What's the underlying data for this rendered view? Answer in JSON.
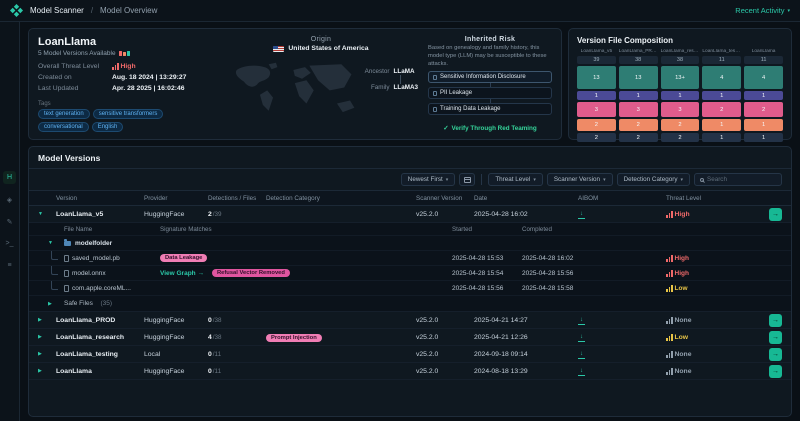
{
  "icons": {
    "caret_down": "▼",
    "caret_right": "▶",
    "caret_small": "▾",
    "arrow": "→",
    "download": "↓",
    "check": "✓"
  },
  "colors": {
    "accent": "#2bc8a8",
    "threat_high": "#f16a6a",
    "threat_low": "#e8c547",
    "threat_none": "#93a1ae"
  },
  "topbar": {
    "breadcrumb": [
      "Model Scanner",
      "Model Overview"
    ],
    "separator": "/",
    "recent_activity": "Recent Activity"
  },
  "sidebar": {
    "items": [
      {
        "name": "home",
        "glyph": "H"
      },
      {
        "name": "models",
        "glyph": "◈"
      },
      {
        "name": "edit",
        "glyph": "✎"
      },
      {
        "name": "console",
        "glyph": ">_"
      },
      {
        "name": "layers",
        "glyph": "≡"
      }
    ]
  },
  "model_card": {
    "title": "LoanLlama",
    "subtitle": "5 Model Versions Available",
    "threat_label": "Overall Threat Level",
    "threat_value": "High",
    "created_label": "Created on",
    "created_value": "Aug. 18 2024 | 13:29:27",
    "updated_label": "Last Updated",
    "updated_value": "Apr. 28 2025 | 16:02:46",
    "tags_label": "Tags",
    "tags": [
      "text generation",
      "sensitive transformers",
      "conversational",
      "English"
    ]
  },
  "origin": {
    "title": "Origin",
    "country": "United States of America",
    "ancestor_label": "Ancestor",
    "ancestor_value": "LLaMA",
    "family_label": "Family",
    "family_value": "LLaMA3"
  },
  "inherited_risk": {
    "title": "Inherited Risk",
    "description": "Based on genealogy and family history, this model type (LLM) may be susceptible to these attacks.",
    "items": [
      "Sensitive Information Disclosure",
      "PII Leakage",
      "Training Data Leakage"
    ],
    "verify_label": "Verify Through Red Teaming"
  },
  "version_file_composition": {
    "title": "Version File Composition",
    "columns": [
      {
        "label": "LoanLlama_v5",
        "chip": "39",
        "cells": [
          {
            "value": "13",
            "color": "#2e7d74"
          },
          {
            "value": "1",
            "color": "#4b4a96"
          },
          {
            "value": "3",
            "color": "#e05c8c"
          },
          {
            "value": "2",
            "color": "#ef8a66"
          },
          {
            "value": "2",
            "color": "#233247"
          }
        ]
      },
      {
        "label": "LoanLlama_PROD",
        "chip": "38",
        "cells": [
          {
            "value": "13",
            "color": "#2e7d74"
          },
          {
            "value": "1",
            "color": "#4b4a96"
          },
          {
            "value": "3",
            "color": "#e05c8c"
          },
          {
            "value": "2",
            "color": "#ef8a66"
          },
          {
            "value": "2",
            "color": "#233247"
          }
        ]
      },
      {
        "label": "LoanLlama_research",
        "chip": "38",
        "cells": [
          {
            "value": "13+",
            "color": "#2e7d74"
          },
          {
            "value": "1",
            "color": "#4b4a96"
          },
          {
            "value": "3",
            "color": "#e05c8c"
          },
          {
            "value": "2",
            "color": "#ef8a66"
          },
          {
            "value": "2",
            "color": "#233247"
          }
        ]
      },
      {
        "label": "LoanLlama_testing",
        "chip": "11",
        "cells": [
          {
            "value": "4",
            "color": "#2e7d74"
          },
          {
            "value": "1",
            "color": "#4b4a96"
          },
          {
            "value": "2",
            "color": "#e05c8c"
          },
          {
            "value": "1",
            "color": "#ef8a66"
          },
          {
            "value": "1",
            "color": "#233247"
          }
        ]
      },
      {
        "label": "LoanLlama",
        "chip": "11",
        "cells": [
          {
            "value": "4",
            "color": "#2e7d74"
          },
          {
            "value": "1",
            "color": "#4b4a96"
          },
          {
            "value": "2",
            "color": "#e05c8c"
          },
          {
            "value": "1",
            "color": "#ef8a66"
          },
          {
            "value": "1",
            "color": "#233247"
          }
        ]
      }
    ]
  },
  "model_versions": {
    "title": "Model Versions",
    "filters": {
      "sort": "Newest First",
      "threat": "Threat Level",
      "scanner": "Scanner Version",
      "category": "Detection Category",
      "search_placeholder": "Search"
    },
    "headers": [
      "Version",
      "Provider",
      "Detections / Files",
      "Detection Category",
      "Scanner Version",
      "Date",
      "AIBOM",
      "Threat Level"
    ],
    "sub_headers": [
      "File Name",
      "Signature Matches",
      "Started",
      "Completed"
    ],
    "rows": [
      {
        "version": "LoanLlama_v5",
        "provider": "HuggingFace",
        "detections": "2",
        "files": "/39",
        "category": "",
        "scanner": "v25.2.0",
        "date": "2025-04-28 16:02",
        "threat": "High",
        "threat_level": "high",
        "expanded": true
      },
      {
        "version": "LoanLlama_PROD",
        "provider": "HuggingFace",
        "detections": "0",
        "files": "/38",
        "category": "",
        "scanner": "v25.2.0",
        "date": "2025-04-21 14:27",
        "threat": "None",
        "threat_level": "none"
      },
      {
        "version": "LoanLlama_research",
        "provider": "HuggingFace",
        "detections": "4",
        "files": "/38",
        "category": "Prompt Injection",
        "badge_color": "#f07db4",
        "scanner": "v25.2.0",
        "date": "2025-04-21 12:26",
        "threat": "Low",
        "threat_level": "low"
      },
      {
        "version": "LoanLlama_testing",
        "provider": "Local",
        "detections": "0",
        "files": "/11",
        "category": "",
        "scanner": "v25.2.0",
        "date": "2024-09-18 09:14",
        "threat": "None",
        "threat_level": "none"
      },
      {
        "version": "LoanLlama",
        "provider": "HuggingFace",
        "detections": "0",
        "files": "/11",
        "category": "",
        "scanner": "v25.2.0",
        "date": "2024-08-18 13:29",
        "threat": "None",
        "threat_level": "none"
      }
    ],
    "expanded": {
      "folder": "modelfolder",
      "files": [
        {
          "name": "saved_model.pb",
          "badge": "Data Leakage",
          "badge_color": "#f07db4",
          "started": "2025-04-28 15:53",
          "completed": "2025-04-28 16:02",
          "threat": "High",
          "threat_level": "high"
        },
        {
          "name": "model.onnx",
          "link": "View Graph →",
          "badge": "Refusal Vector Removed",
          "badge_color": "#e0559f",
          "started": "2025-04-28 15:54",
          "completed": "2025-04-28 15:56",
          "threat": "High",
          "threat_level": "high"
        },
        {
          "name": "com.apple.coreML...",
          "started": "2025-04-28 15:56",
          "completed": "2025-04-28 15:58",
          "threat": "Low",
          "threat_level": "low"
        }
      ],
      "safe_files": "Safe Files",
      "safe_count": "(35)"
    }
  }
}
